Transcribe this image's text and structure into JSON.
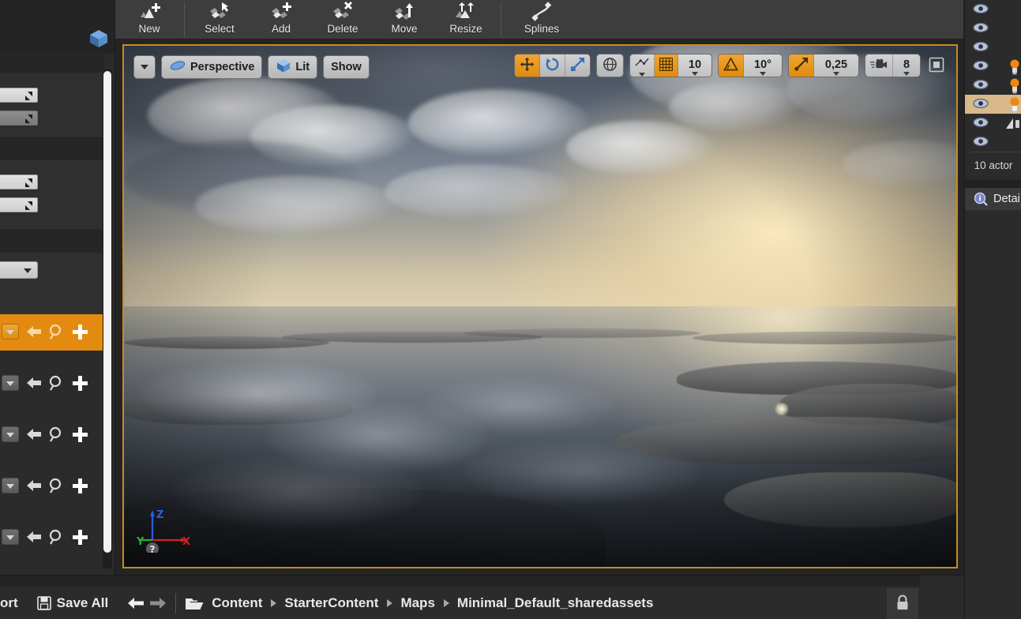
{
  "app": {
    "accent_orange": "#e08c0d",
    "panel_bg": "#2b2b2b",
    "viewport_border": "#c98a1e"
  },
  "landscape_toolbar": {
    "items": [
      {
        "label": "New",
        "icon": "landscape-new-icon"
      },
      {
        "label": "Select",
        "icon": "landscape-select-icon"
      },
      {
        "label": "Add",
        "icon": "landscape-add-icon"
      },
      {
        "label": "Delete",
        "icon": "landscape-delete-icon"
      },
      {
        "label": "Move",
        "icon": "landscape-move-icon"
      },
      {
        "label": "Resize",
        "icon": "landscape-resize-icon"
      },
      {
        "label": "Splines",
        "icon": "landscape-splines-icon"
      }
    ]
  },
  "viewport": {
    "options_caret": "",
    "camera_mode": {
      "label": "Perspective",
      "icon": "camera-perspective-icon"
    },
    "view_mode": {
      "label": "Lit",
      "icon": "view-lit-icon"
    },
    "show_menu": {
      "label": "Show"
    },
    "transform_tools": [
      {
        "name": "translate",
        "icon": "translate-gizmo-icon",
        "active": true
      },
      {
        "name": "rotate",
        "icon": "rotate-gizmo-icon",
        "active": false
      },
      {
        "name": "scale",
        "icon": "scale-gizmo-icon",
        "active": false
      }
    ],
    "coordinate_system": {
      "icon": "world-globe-icon",
      "active": false
    },
    "surface_snap": {
      "icon": "surface-snap-icon",
      "active": false
    },
    "grid_snap": {
      "icon": "grid-snap-icon",
      "active": true,
      "value": "10"
    },
    "rotation_snap": {
      "icon": "angle-snap-icon",
      "active": true,
      "value": "10°"
    },
    "scale_snap": {
      "icon": "scale-snap-icon",
      "active": true,
      "value": "0,25"
    },
    "camera_speed": {
      "icon": "camera-speed-icon",
      "value": "8"
    },
    "maximize": {
      "icon": "maximize-viewport-icon"
    },
    "gizmo": {
      "x_label": "X",
      "y_label": "Y",
      "z_label": "Z",
      "help_label": "?"
    }
  },
  "outliner": {
    "rows": [
      {
        "visible_icon": "eye-icon",
        "selected": false,
        "type_icon": ""
      },
      {
        "visible_icon": "eye-icon",
        "selected": false,
        "type_icon": ""
      },
      {
        "visible_icon": "eye-icon",
        "selected": false,
        "type_icon": ""
      },
      {
        "visible_icon": "eye-icon",
        "selected": false,
        "type_icon": "point-light-icon"
      },
      {
        "visible_icon": "eye-icon",
        "selected": false,
        "type_icon": "point-light-icon"
      },
      {
        "visible_icon": "eye-icon",
        "selected": true,
        "type_icon": "point-light-icon"
      },
      {
        "visible_icon": "eye-icon",
        "selected": false,
        "type_icon": "cone-light-icon"
      },
      {
        "visible_icon": "eye-icon",
        "selected": false,
        "type_icon": ""
      }
    ],
    "count_label": "10 actor",
    "details_tab": {
      "label": "Detai",
      "icon": "details-info-icon"
    }
  },
  "left_panel": {
    "logo_icon": "unreal-cube-icon",
    "number_fields": [
      {
        "name": "field-1",
        "style": "light"
      },
      {
        "name": "field-2",
        "style": "gray"
      },
      {
        "name": "field-3",
        "style": "light"
      },
      {
        "name": "field-4",
        "style": "light"
      }
    ],
    "combo": {
      "name": "material-combo",
      "caret_icon": "chevron-down-icon"
    },
    "asset_rows": [
      {
        "highlighted": true,
        "icons": [
          "chevron-down-icon",
          "use-selected-arrow-icon",
          "browse-asset-icon",
          "new-asset-plus-icon"
        ]
      },
      {
        "highlighted": false,
        "icons": [
          "chevron-down-icon",
          "use-selected-arrow-icon",
          "browse-asset-icon",
          "new-asset-plus-icon"
        ]
      },
      {
        "highlighted": false,
        "icons": [
          "chevron-down-icon",
          "use-selected-arrow-icon",
          "browse-asset-icon",
          "new-asset-plus-icon"
        ]
      },
      {
        "highlighted": false,
        "icons": [
          "chevron-down-icon",
          "use-selected-arrow-icon",
          "browse-asset-icon",
          "new-asset-plus-icon"
        ]
      },
      {
        "highlighted": false,
        "icons": [
          "chevron-down-icon",
          "use-selected-arrow-icon",
          "browse-asset-icon",
          "new-asset-plus-icon"
        ]
      }
    ]
  },
  "bottom_bar": {
    "import_label": "ort",
    "save_all_label": "Save All",
    "save_icon": "save-disk-icon",
    "back_icon": "nav-back-arrow-icon",
    "forward_icon": "nav-forward-arrow-icon",
    "folder_icon": "folder-open-icon",
    "breadcrumbs": [
      "Content",
      "StarterContent",
      "Maps",
      "Minimal_Default_sharedassets"
    ],
    "lock_icon": "lock-icon"
  }
}
